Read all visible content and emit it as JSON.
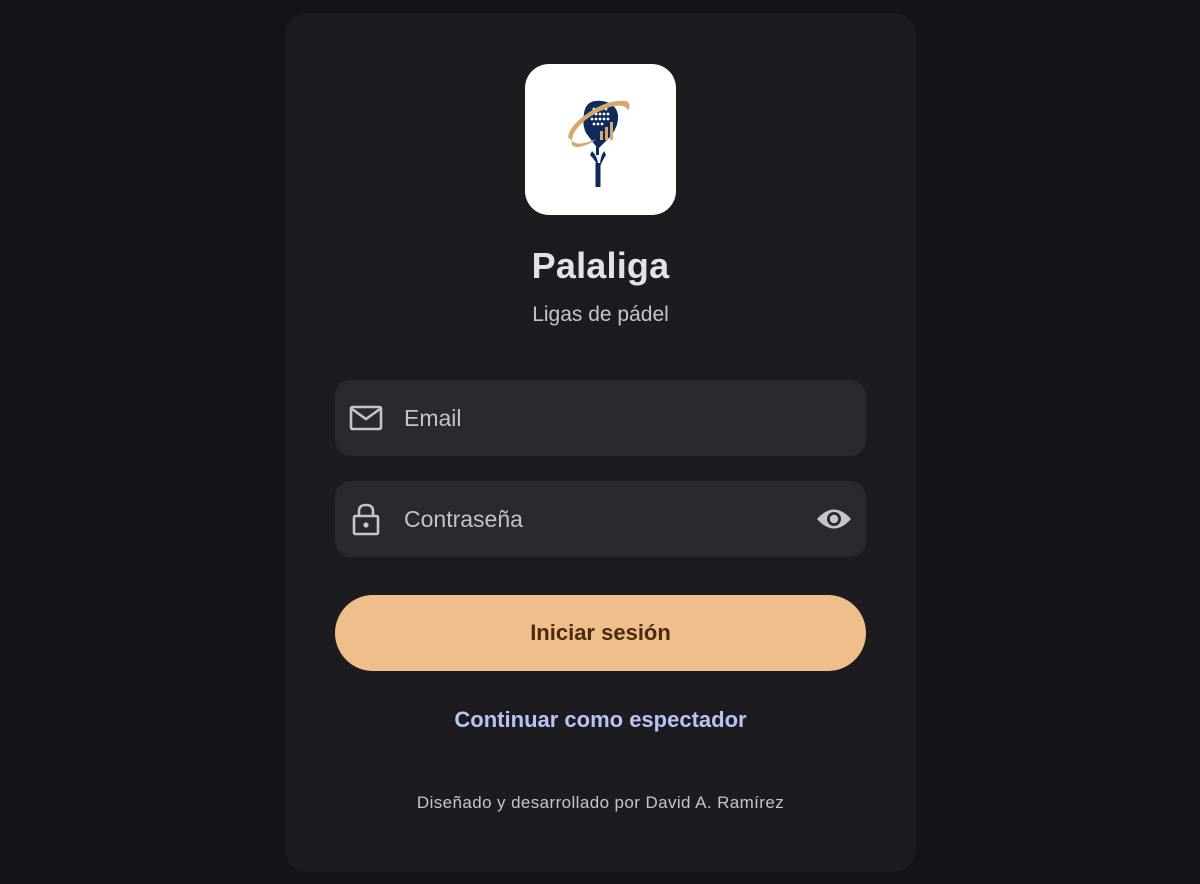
{
  "app": {
    "title": "Palaliga",
    "subtitle": "Ligas de pádel",
    "logo_icon": "padel-racket-logo-icon"
  },
  "form": {
    "email": {
      "placeholder": "Email",
      "value": "",
      "icon": "mail-icon"
    },
    "password": {
      "placeholder": "Contraseña",
      "value": "",
      "icon": "lock-icon",
      "toggle_icon": "eye-icon"
    },
    "submit_label": "Iniciar sesión",
    "spectator_label": "Continuar como espectador"
  },
  "footer": {
    "credit": "Diseñado y desarrollado por David A. Ramírez"
  },
  "colors": {
    "background": "#131318",
    "card": "#1c1b20",
    "field": "#29292e",
    "primary_button": "#f0be8b",
    "link": "#b9c4f5",
    "logo_navy": "#0f2a5c",
    "logo_gold": "#d8a868"
  }
}
